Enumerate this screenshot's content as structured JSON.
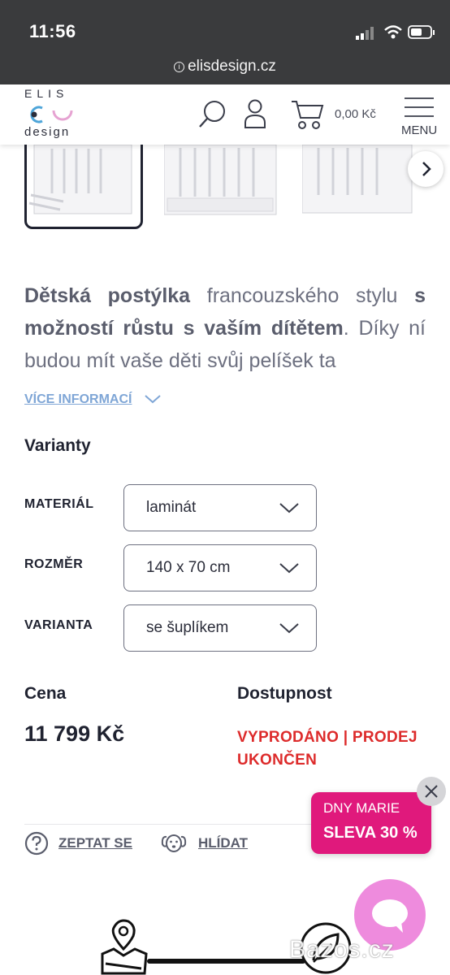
{
  "status_bar": {
    "time": "11:56",
    "url": "elisdesign.cz"
  },
  "header": {
    "logo_top": "ELIS",
    "logo_bottom": "design",
    "cart_total": "0,00 Kč",
    "menu_label": "MENU"
  },
  "description": {
    "bold1": "Dětská postýlka",
    "text1": " francouzského stylu ",
    "bold2": "s možností růstu s vaším dítětem",
    "text2": ". Díky ní budou mít vaše děti svůj pelíšek ta",
    "more_link": "VÍCE INFORMACÍ"
  },
  "variants": {
    "heading": "Varianty",
    "options": [
      {
        "label": "MATERIÁL",
        "value": "laminát"
      },
      {
        "label": "ROZMĚR",
        "value": "140 x 70 cm"
      },
      {
        "label": "VARIANTA",
        "value": "se šuplíkem"
      }
    ]
  },
  "price": {
    "heading": "Cena",
    "value": "11 799 Kč"
  },
  "availability": {
    "heading": "Dostupnost",
    "value": "VYPRODÁNO | PRODEJ UKONČEN"
  },
  "actions": {
    "ask": "ZEPTAT SE",
    "watch": "HLÍDAT"
  },
  "promo": {
    "line1": "DNY MARIE",
    "line2": "SLEVA 30 %"
  },
  "watermark": "Bazos.cz",
  "colors": {
    "accent_pink": "#e0197c",
    "chat_pink": "#ee8bdd",
    "soldout_red": "#dd2b2b",
    "link_blue": "#7fa6d6"
  }
}
